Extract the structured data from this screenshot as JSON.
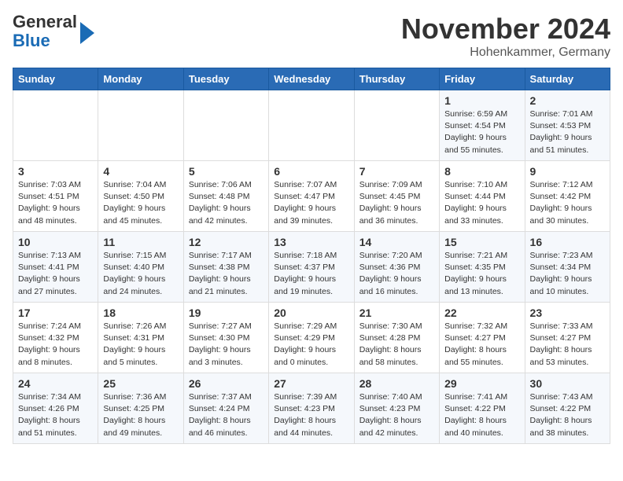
{
  "logo": {
    "general": "General",
    "blue": "Blue"
  },
  "title": "November 2024",
  "location": "Hohenkammer, Germany",
  "days_of_week": [
    "Sunday",
    "Monday",
    "Tuesday",
    "Wednesday",
    "Thursday",
    "Friday",
    "Saturday"
  ],
  "weeks": [
    [
      {
        "day": "",
        "info": ""
      },
      {
        "day": "",
        "info": ""
      },
      {
        "day": "",
        "info": ""
      },
      {
        "day": "",
        "info": ""
      },
      {
        "day": "",
        "info": ""
      },
      {
        "day": "1",
        "info": "Sunrise: 6:59 AM\nSunset: 4:54 PM\nDaylight: 9 hours and 55 minutes."
      },
      {
        "day": "2",
        "info": "Sunrise: 7:01 AM\nSunset: 4:53 PM\nDaylight: 9 hours and 51 minutes."
      }
    ],
    [
      {
        "day": "3",
        "info": "Sunrise: 7:03 AM\nSunset: 4:51 PM\nDaylight: 9 hours and 48 minutes."
      },
      {
        "day": "4",
        "info": "Sunrise: 7:04 AM\nSunset: 4:50 PM\nDaylight: 9 hours and 45 minutes."
      },
      {
        "day": "5",
        "info": "Sunrise: 7:06 AM\nSunset: 4:48 PM\nDaylight: 9 hours and 42 minutes."
      },
      {
        "day": "6",
        "info": "Sunrise: 7:07 AM\nSunset: 4:47 PM\nDaylight: 9 hours and 39 minutes."
      },
      {
        "day": "7",
        "info": "Sunrise: 7:09 AM\nSunset: 4:45 PM\nDaylight: 9 hours and 36 minutes."
      },
      {
        "day": "8",
        "info": "Sunrise: 7:10 AM\nSunset: 4:44 PM\nDaylight: 9 hours and 33 minutes."
      },
      {
        "day": "9",
        "info": "Sunrise: 7:12 AM\nSunset: 4:42 PM\nDaylight: 9 hours and 30 minutes."
      }
    ],
    [
      {
        "day": "10",
        "info": "Sunrise: 7:13 AM\nSunset: 4:41 PM\nDaylight: 9 hours and 27 minutes."
      },
      {
        "day": "11",
        "info": "Sunrise: 7:15 AM\nSunset: 4:40 PM\nDaylight: 9 hours and 24 minutes."
      },
      {
        "day": "12",
        "info": "Sunrise: 7:17 AM\nSunset: 4:38 PM\nDaylight: 9 hours and 21 minutes."
      },
      {
        "day": "13",
        "info": "Sunrise: 7:18 AM\nSunset: 4:37 PM\nDaylight: 9 hours and 19 minutes."
      },
      {
        "day": "14",
        "info": "Sunrise: 7:20 AM\nSunset: 4:36 PM\nDaylight: 9 hours and 16 minutes."
      },
      {
        "day": "15",
        "info": "Sunrise: 7:21 AM\nSunset: 4:35 PM\nDaylight: 9 hours and 13 minutes."
      },
      {
        "day": "16",
        "info": "Sunrise: 7:23 AM\nSunset: 4:34 PM\nDaylight: 9 hours and 10 minutes."
      }
    ],
    [
      {
        "day": "17",
        "info": "Sunrise: 7:24 AM\nSunset: 4:32 PM\nDaylight: 9 hours and 8 minutes."
      },
      {
        "day": "18",
        "info": "Sunrise: 7:26 AM\nSunset: 4:31 PM\nDaylight: 9 hours and 5 minutes."
      },
      {
        "day": "19",
        "info": "Sunrise: 7:27 AM\nSunset: 4:30 PM\nDaylight: 9 hours and 3 minutes."
      },
      {
        "day": "20",
        "info": "Sunrise: 7:29 AM\nSunset: 4:29 PM\nDaylight: 9 hours and 0 minutes."
      },
      {
        "day": "21",
        "info": "Sunrise: 7:30 AM\nSunset: 4:28 PM\nDaylight: 8 hours and 58 minutes."
      },
      {
        "day": "22",
        "info": "Sunrise: 7:32 AM\nSunset: 4:27 PM\nDaylight: 8 hours and 55 minutes."
      },
      {
        "day": "23",
        "info": "Sunrise: 7:33 AM\nSunset: 4:27 PM\nDaylight: 8 hours and 53 minutes."
      }
    ],
    [
      {
        "day": "24",
        "info": "Sunrise: 7:34 AM\nSunset: 4:26 PM\nDaylight: 8 hours and 51 minutes."
      },
      {
        "day": "25",
        "info": "Sunrise: 7:36 AM\nSunset: 4:25 PM\nDaylight: 8 hours and 49 minutes."
      },
      {
        "day": "26",
        "info": "Sunrise: 7:37 AM\nSunset: 4:24 PM\nDaylight: 8 hours and 46 minutes."
      },
      {
        "day": "27",
        "info": "Sunrise: 7:39 AM\nSunset: 4:23 PM\nDaylight: 8 hours and 44 minutes."
      },
      {
        "day": "28",
        "info": "Sunrise: 7:40 AM\nSunset: 4:23 PM\nDaylight: 8 hours and 42 minutes."
      },
      {
        "day": "29",
        "info": "Sunrise: 7:41 AM\nSunset: 4:22 PM\nDaylight: 8 hours and 40 minutes."
      },
      {
        "day": "30",
        "info": "Sunrise: 7:43 AM\nSunset: 4:22 PM\nDaylight: 8 hours and 38 minutes."
      }
    ]
  ]
}
